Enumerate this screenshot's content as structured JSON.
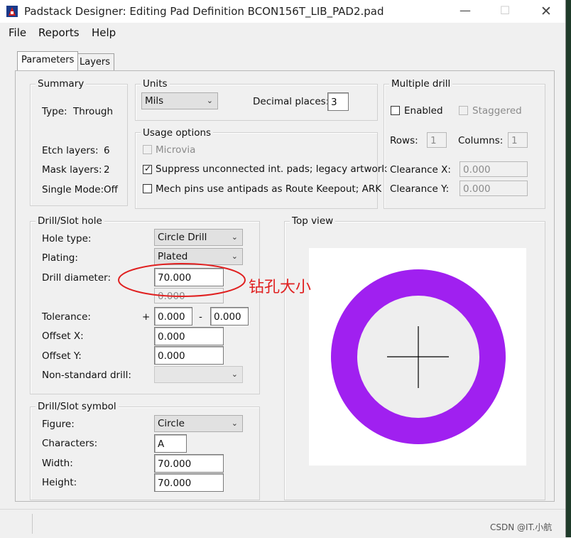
{
  "window": {
    "title": "Padstack Designer: Editing Pad Definition BCON156T_LIB_PAD2.pad"
  },
  "menu": [
    "File",
    "Reports",
    "Help"
  ],
  "tabs": [
    "Parameters",
    "Layers"
  ],
  "summary": {
    "title": "Summary",
    "type_label": "Type:",
    "type_value": "Through",
    "etch_label": "Etch layers:",
    "etch_value": "6",
    "mask_label": "Mask layers:",
    "mask_value": "2",
    "single_label": "Single Mode:",
    "single_value": "Off"
  },
  "units": {
    "title": "Units",
    "unit_value": "Mils",
    "decimal_label": "Decimal places:",
    "decimal_value": "3"
  },
  "usage": {
    "title": "Usage options",
    "microvia": "Microvia",
    "suppress": "Suppress unconnected int. pads; legacy artwork",
    "mech": "Mech pins use antipads as Route Keepout; ARK"
  },
  "multiple_drill": {
    "title": "Multiple drill",
    "enabled": "Enabled",
    "staggered": "Staggered",
    "rows_label": "Rows:",
    "rows_value": "1",
    "columns_label": "Columns:",
    "columns_value": "1",
    "clearance_x_label": "Clearance X:",
    "clearance_x_value": "0.000",
    "clearance_y_label": "Clearance Y:",
    "clearance_y_value": "0.000"
  },
  "drill_hole": {
    "title": "Drill/Slot hole",
    "hole_type_label": "Hole type:",
    "hole_type_value": "Circle Drill",
    "plating_label": "Plating:",
    "plating_value": "Plated",
    "drill_diameter_label": "Drill diameter:",
    "drill_diameter_value": "70.000",
    "secondary_value": "0.000",
    "tolerance_label": "Tolerance:",
    "tol_plus": "+",
    "tol_plus_value": "0.000",
    "tol_minus": "-",
    "tol_minus_value": "0.000",
    "offset_x_label": "Offset X:",
    "offset_x_value": "0.000",
    "offset_y_label": "Offset Y:",
    "offset_y_value": "0.000",
    "nonstandard_label": "Non-standard drill:",
    "nonstandard_value": ""
  },
  "drill_symbol": {
    "title": "Drill/Slot symbol",
    "figure_label": "Figure:",
    "figure_value": "Circle",
    "characters_label": "Characters:",
    "characters_value": "A",
    "width_label": "Width:",
    "width_value": "70.000",
    "height_label": "Height:",
    "height_value": "70.000"
  },
  "top_view": {
    "title": "Top view"
  },
  "annotation": "钻孔大小",
  "watermark": "CSDN @IT.小航",
  "colors": {
    "pad_ring": "#a020f0",
    "annotation": "#e02020"
  }
}
